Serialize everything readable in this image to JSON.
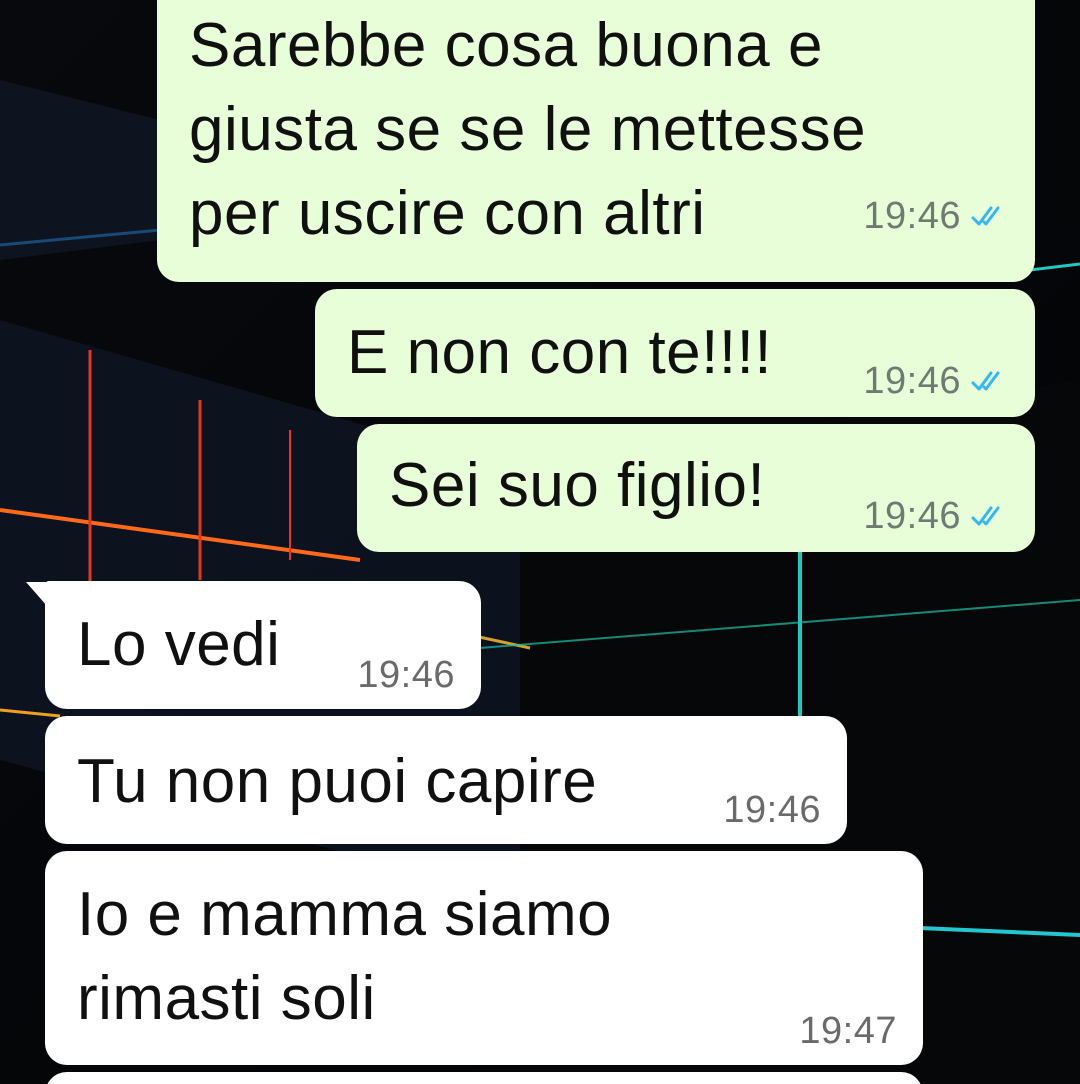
{
  "colors": {
    "outgoing_bubble": "#e7fed8",
    "incoming_bubble": "#ffffff",
    "read_ticks": "#34b7f1",
    "wallpaper": "#000000"
  },
  "messages": [
    {
      "direction": "outgoing",
      "text": "Sarebbe cosa buona e\ngiusta se se le mettesse\nper uscire con altri",
      "time": "19:46",
      "status": "read",
      "status_icon": "double-check-icon"
    },
    {
      "direction": "outgoing",
      "text": "E non con te!!!!",
      "time": "19:46",
      "status": "read",
      "status_icon": "double-check-icon"
    },
    {
      "direction": "outgoing",
      "text": "Sei suo figlio!",
      "time": "19:46",
      "status": "read",
      "status_icon": "double-check-icon"
    },
    {
      "direction": "incoming",
      "text": "Lo vedi",
      "time": "19:46"
    },
    {
      "direction": "incoming",
      "text": "Tu non puoi capire",
      "time": "19:46"
    },
    {
      "direction": "incoming",
      "text": "Io e mamma siamo\nrimasti soli",
      "time": "19:47"
    }
  ]
}
